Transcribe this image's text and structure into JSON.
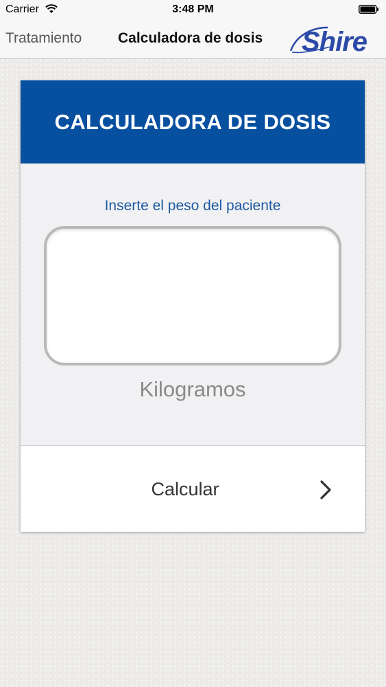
{
  "status_bar": {
    "carrier": "Carrier",
    "time": "3:48 PM",
    "wifi_icon": "wifi-icon",
    "battery_icon": "battery-icon"
  },
  "nav": {
    "back_label": "Tratamiento",
    "title": "Calculadora de dosis",
    "logo_text": "Shire"
  },
  "card": {
    "title": "CALCULADORA DE DOSIS",
    "weight_label": "Inserte el peso del paciente",
    "weight_value": "",
    "unit_label": "Kilogramos",
    "button_label": "Calcular",
    "button_icon": "chevron-right-icon"
  },
  "colors": {
    "header_blue": "#0750a0",
    "label_blue": "#1d5aa3",
    "logo_blue": "#2c4aa8"
  }
}
